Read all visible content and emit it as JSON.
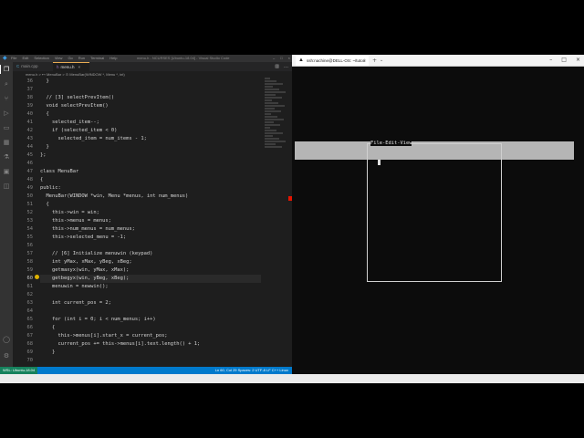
{
  "vscode": {
    "window_title": "menu.h - NCURSES [Ubuntu-18.04] - Visual Studio Code",
    "menu": [
      "File",
      "Edit",
      "Selection",
      "View",
      "Go",
      "Run",
      "Terminal",
      "Help"
    ],
    "tabs": [
      {
        "icon": "C",
        "label": "main.cpp",
        "active": false
      },
      {
        "icon": "h",
        "label": "menu.h",
        "active": true
      }
    ],
    "breadcrumb": "menu.h > ⊷ MenuBar > ⊙ MenuBar(WINDOW *, Menu *, int)",
    "gutter": [
      "36",
      "37",
      "38",
      "39",
      "40",
      "41",
      "42",
      "43",
      "44",
      "45",
      "46",
      "47",
      "48",
      "49",
      "50",
      "51",
      "52",
      "53",
      "54",
      "55",
      "56",
      "57",
      "58",
      "59",
      "60",
      "61",
      "62",
      "63",
      "64",
      "65",
      "66",
      "67",
      "68",
      "69",
      "70"
    ],
    "code": [
      "  }",
      "",
      "  // [3] selectPrevItem()",
      "  void selectPrevItem()",
      "  {",
      "    selected_item--;",
      "    if (selected_item < 0)",
      "      selected_item = num_items - 1;",
      "  }",
      "};",
      "",
      "class MenuBar",
      "{",
      "public:",
      "  MenuBar(WINDOW *win, Menu *menus, int num_menus)",
      "  {",
      "    this->win = win;",
      "    this->menus = menus;",
      "    this->num_menus = num_menus;",
      "    this->selected_menu = -1;",
      "",
      "    // [6] Initialize menuwin (keypad)",
      "    int yMax, xMax, yBeg, xBeg;",
      "    getmaxyx(win, yMax, xMax);",
      "    getbegyx(win, yBeg, xBeg);",
      "    menuwin = newwin();",
      "",
      "    int current_pos = 2;",
      "",
      "    for (int i = 0; i < num_menus; i++)",
      "    {",
      "      this->menus[i].start_x = current_pos;",
      "      current_pos += this->menus[i].text.length() + 1;",
      "    }",
      ""
    ],
    "current_line": "60",
    "status_remote": "WSL: Ubuntu-18.04",
    "status_right": "Ln 60, Col 29  Spaces: 2  UTF-8  LF  C++  Linux"
  },
  "terminal": {
    "tab_label": "ssh:nachine@DELL-OS: ~/tutori",
    "menu_text": "File-Edit-View"
  },
  "colors": {
    "editor_bg": "#1e1e1e",
    "statusbar": "#007acc",
    "terminal_bg": "#0c0c0c",
    "menubar_gray": "#b5b5b5"
  }
}
